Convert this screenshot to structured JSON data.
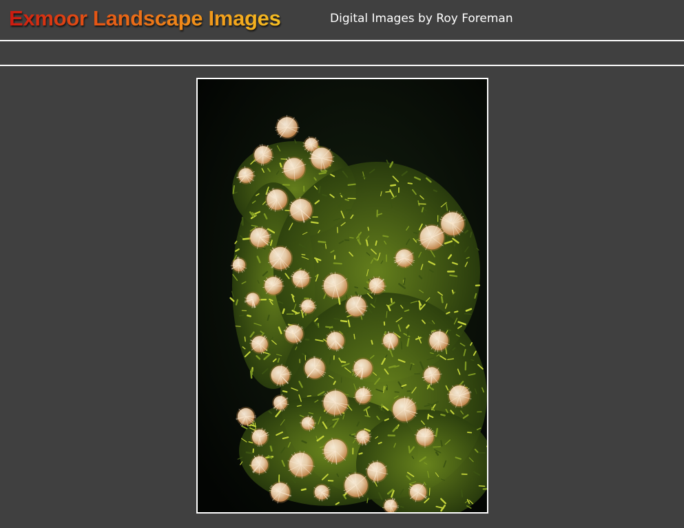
{
  "header": {
    "site_title": "Exmoor Landscape Images",
    "subtitle": "Digital Images by Roy Foreman"
  },
  "photo": {
    "subject": "flowering shrub with fluffy cream blossoms",
    "colors": {
      "background": "#050805",
      "foliage_light": "#b8c832",
      "foliage_dark": "#3d5a14",
      "blossom": "#f2d8b8",
      "blossom_shade": "#d8955a"
    }
  },
  "colors": {
    "page_background": "#404040",
    "divider": "#ffffff",
    "title_gradient_start": "#cc1a10",
    "title_gradient_end": "#f6bf22",
    "subtitle_text": "#ffffff"
  }
}
